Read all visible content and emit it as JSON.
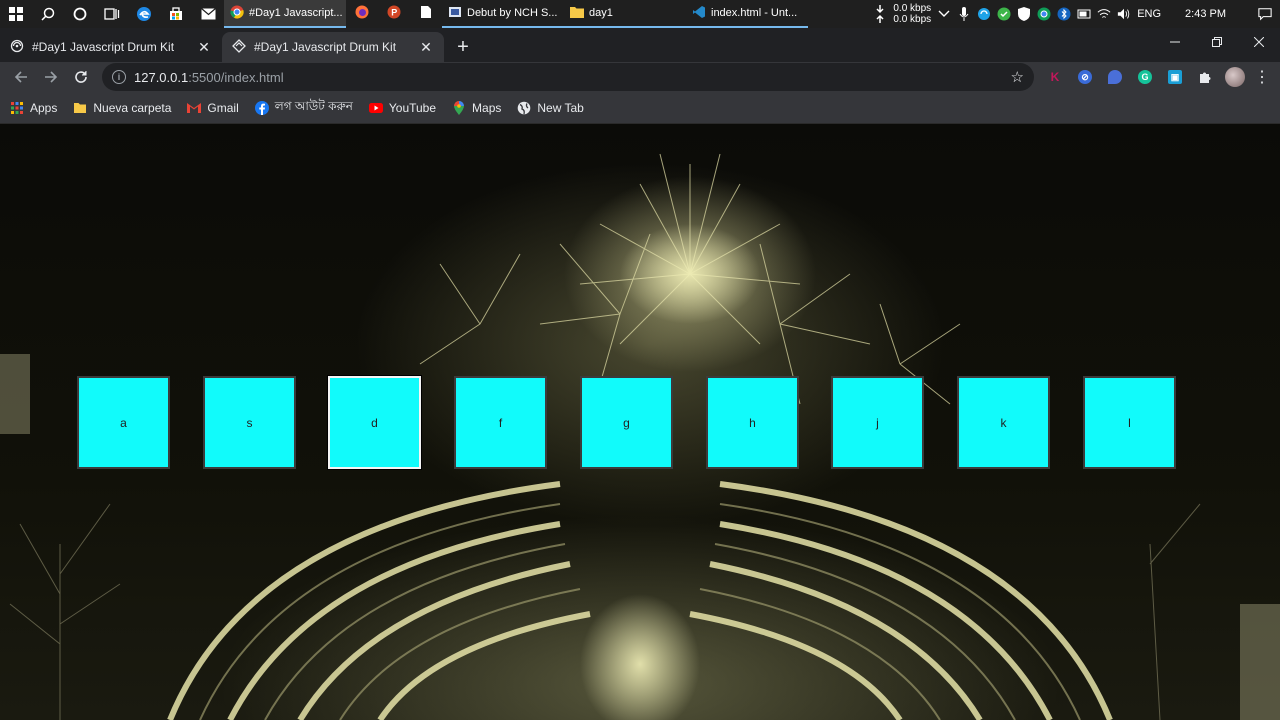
{
  "taskbar": {
    "apps": [
      {
        "label": "#Day1 Javascript...",
        "active": true
      },
      {
        "label": "Debut by NCH S..."
      },
      {
        "label": "day1"
      },
      {
        "label": "index.html - Unt..."
      }
    ],
    "net_up": "0.0 kbps",
    "net_down": "0.0 kbps",
    "lang": "ENG",
    "time": "2:43 PM"
  },
  "browser": {
    "tabs": [
      {
        "title": "#Day1 Javascript Drum Kit",
        "close": "✕"
      },
      {
        "title": "#Day1 Javascript Drum Kit",
        "close": "✕",
        "active": true
      }
    ],
    "new_tab": "+",
    "url_host": "127.0.0.1",
    "url_path": ":5500/index.html",
    "extensions": [
      {
        "icon": "k-extension-icon",
        "text": "K",
        "color": "#c2185b"
      },
      {
        "icon": "blocker-extension-icon",
        "text": "⊘",
        "color": "#3a6bd8"
      },
      {
        "icon": "chat-extension-icon",
        "text": "●",
        "color": "#4a6fd8"
      },
      {
        "icon": "grammarly-icon",
        "text": "G",
        "color": "#15c39a"
      },
      {
        "icon": "calendar-extension-icon",
        "text": "▣",
        "color": "#1a9fd6"
      }
    ]
  },
  "bookmarks": [
    {
      "icon": "apps-grid-icon",
      "label": "Apps"
    },
    {
      "icon": "folder-icon",
      "label": "Nueva carpeta"
    },
    {
      "icon": "gmail-icon",
      "label": "Gmail"
    },
    {
      "icon": "facebook-icon",
      "label": "লগ আউট করুন"
    },
    {
      "icon": "youtube-icon",
      "label": "YouTube"
    },
    {
      "icon": "maps-icon",
      "label": "Maps"
    },
    {
      "icon": "globe-icon",
      "label": "New Tab"
    }
  ],
  "drumkit": {
    "keys": [
      {
        "letter": "a"
      },
      {
        "letter": "s"
      },
      {
        "letter": "d",
        "playing": true
      },
      {
        "letter": "f"
      },
      {
        "letter": "g"
      },
      {
        "letter": "h"
      },
      {
        "letter": "j"
      },
      {
        "letter": "k"
      },
      {
        "letter": "l"
      }
    ],
    "key_color": "#11fbfb"
  }
}
